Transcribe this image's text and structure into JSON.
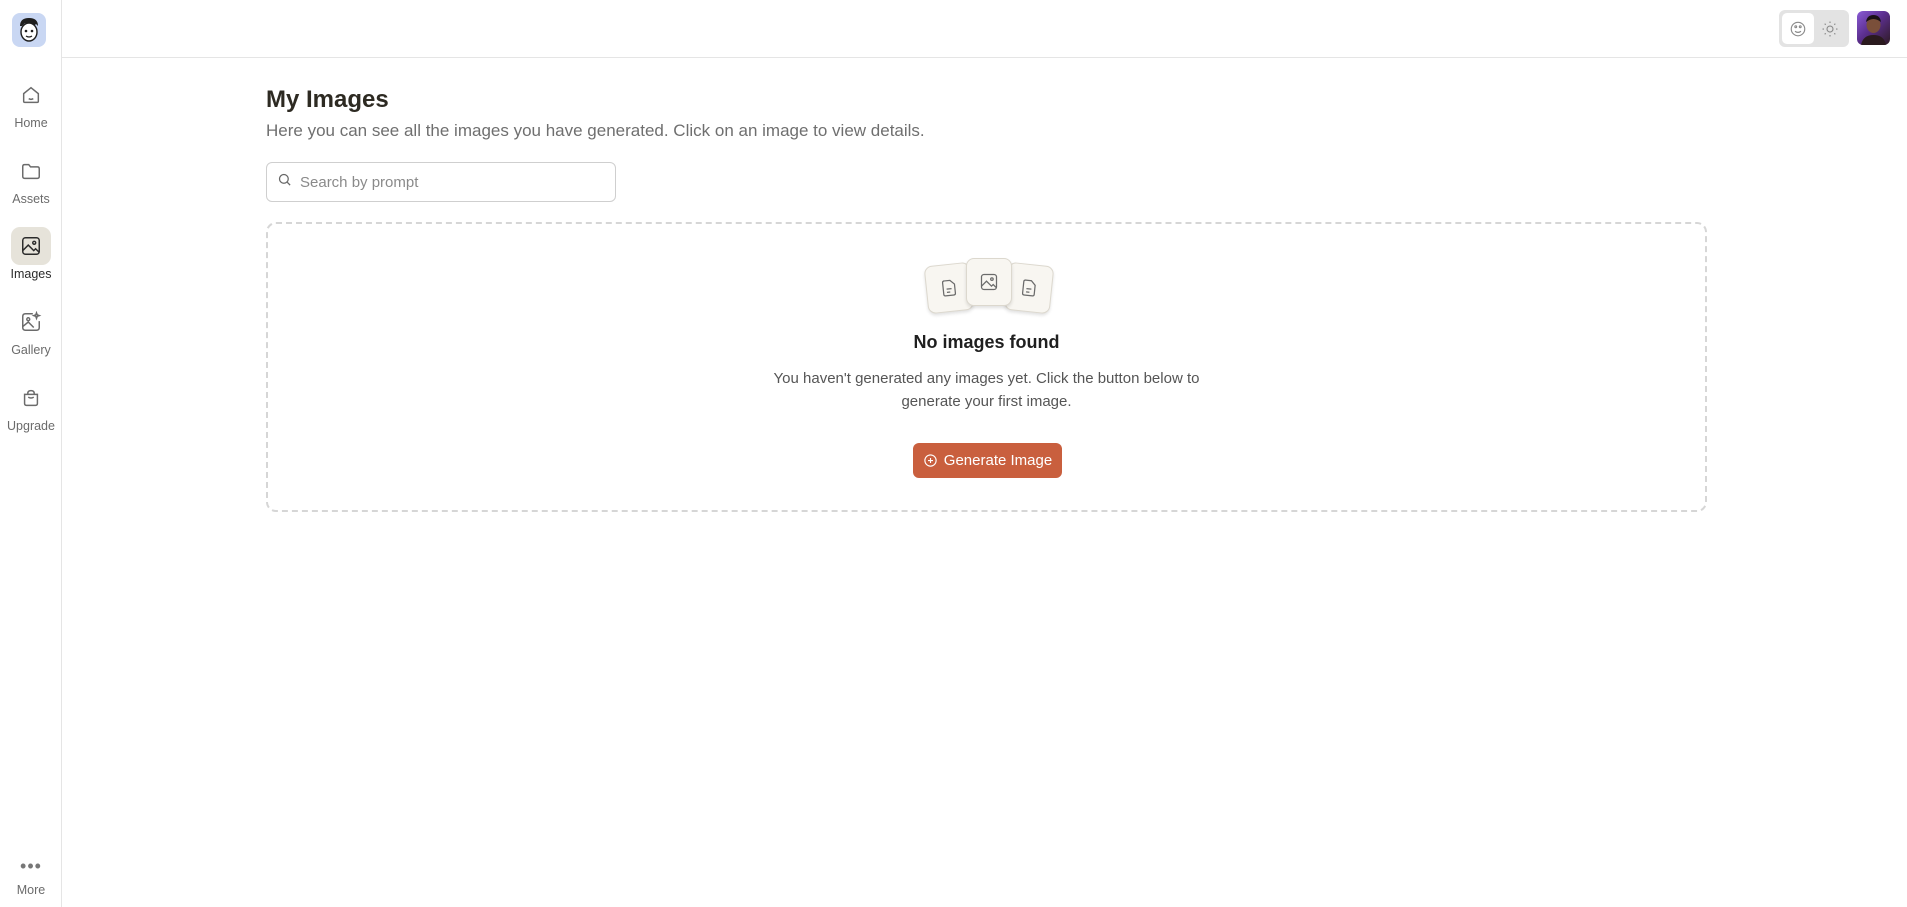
{
  "sidebar": {
    "logo_icon": "cartoon-face-logo",
    "items": [
      {
        "label": "Home",
        "icon": "home-icon"
      },
      {
        "label": "Assets",
        "icon": "folder-icon"
      },
      {
        "label": "Images",
        "icon": "image-icon",
        "active": true
      },
      {
        "label": "Gallery",
        "icon": "image-sparkle-icon"
      },
      {
        "label": "Upgrade",
        "icon": "shopping-bag-icon"
      }
    ],
    "more_label": "More"
  },
  "header": {
    "theme_options": [
      "system-theme-icon",
      "sun-icon"
    ],
    "avatar_icon": "user-avatar"
  },
  "page": {
    "title": "My Images",
    "subtitle": "Here you can see all the images you have generated. Click on an image to view details."
  },
  "search": {
    "placeholder": "Search by prompt",
    "value": ""
  },
  "empty_state": {
    "title": "No images found",
    "text": "You haven't generated any images yet. Click the button below to generate your first image.",
    "button_label": "Generate Image"
  },
  "colors": {
    "accent": "#c95f3e",
    "active_nav": "#e6e3da"
  }
}
